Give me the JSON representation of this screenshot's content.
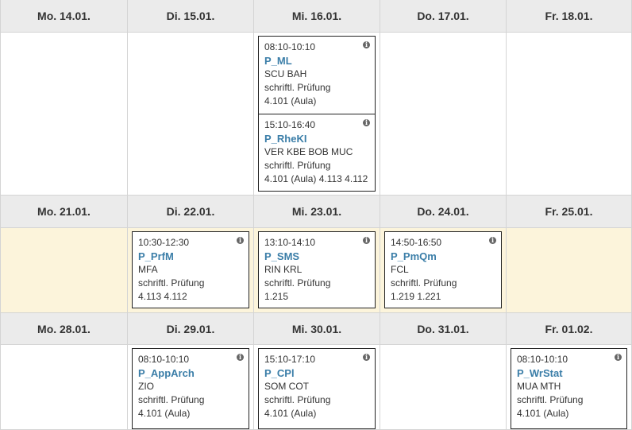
{
  "weeks": [
    {
      "days": [
        {
          "label": "Mo. 14.01."
        },
        {
          "label": "Di. 15.01."
        },
        {
          "label": "Mi. 16.01."
        },
        {
          "label": "Do. 17.01."
        },
        {
          "label": "Fr. 18.01."
        }
      ],
      "events": [
        {
          "day": 2,
          "time": "08:10-10:10",
          "code": "P_ML",
          "people": "SCU BAH",
          "type": "schriftl. Prüfung",
          "rooms": "4.101 (Aula)"
        },
        {
          "day": 2,
          "time": "15:10-16:40",
          "code": "P_RheKI",
          "people": "VER KBE BOB MUC",
          "type": "schriftl. Prüfung",
          "rooms": "4.101 (Aula) 4.113 4.112"
        }
      ]
    },
    {
      "days": [
        {
          "label": "Mo. 21.01."
        },
        {
          "label": "Di. 22.01."
        },
        {
          "label": "Mi. 23.01."
        },
        {
          "label": "Do. 24.01."
        },
        {
          "label": "Fr. 25.01."
        }
      ],
      "events": [
        {
          "day": 1,
          "time": "10:30-12:30",
          "code": "P_PrfM",
          "people": "MFA",
          "type": "schriftl. Prüfung",
          "rooms": "4.113 4.112"
        },
        {
          "day": 2,
          "time": "13:10-14:10",
          "code": "P_SMS",
          "people": "RIN KRL",
          "type": "schriftl. Prüfung",
          "rooms": "1.215"
        },
        {
          "day": 3,
          "time": "14:50-16:50",
          "code": "P_PmQm",
          "people": "FCL",
          "type": "schriftl. Prüfung",
          "rooms": "1.219 1.221"
        }
      ]
    },
    {
      "days": [
        {
          "label": "Mo. 28.01."
        },
        {
          "label": "Di. 29.01."
        },
        {
          "label": "Mi. 30.01."
        },
        {
          "label": "Do. 31.01."
        },
        {
          "label": "Fr. 01.02."
        }
      ],
      "events": [
        {
          "day": 1,
          "time": "08:10-10:10",
          "code": "P_AppArch",
          "people": "ZIO",
          "type": "schriftl. Prüfung",
          "rooms": "4.101 (Aula)"
        },
        {
          "day": 2,
          "time": "15:10-17:10",
          "code": "P_CPl",
          "people": "SOM COT",
          "type": "schriftl. Prüfung",
          "rooms": "4.101 (Aula)"
        },
        {
          "day": 4,
          "time": "08:10-10:10",
          "code": "P_WrStat",
          "people": "MUA MTH",
          "type": "schriftl. Prüfung",
          "rooms": "4.101 (Aula)"
        }
      ]
    }
  ],
  "icons": {
    "info": "info-icon"
  }
}
